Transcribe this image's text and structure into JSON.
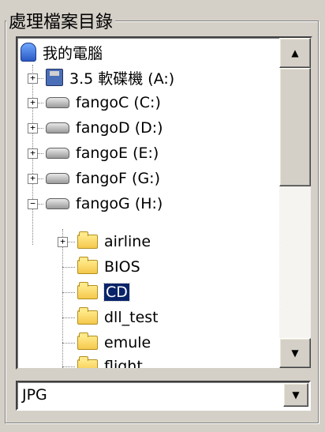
{
  "group_title": "處理檔案目錄",
  "tree": [
    {
      "label": "我的電腦",
      "icon": "computer-icon",
      "expander": ""
    },
    {
      "label": "3.5 軟碟機 (A:)",
      "icon": "floppy-drive-icon",
      "expander": "+"
    },
    {
      "label": "fangoC (C:)",
      "icon": "hard-drive-icon",
      "expander": "+"
    },
    {
      "label": "fangoD (D:)",
      "icon": "hard-drive-icon",
      "expander": "+"
    },
    {
      "label": "fangoE (E:)",
      "icon": "hard-drive-icon",
      "expander": "+"
    },
    {
      "label": "fangoF (G:)",
      "icon": "hard-drive-icon",
      "expander": "+"
    },
    {
      "label": "fangoG (H:)",
      "icon": "hard-drive-icon",
      "expander": "−"
    },
    {
      "label": "airline",
      "icon": "folder-icon",
      "expander": "+"
    },
    {
      "label": "BIOS",
      "icon": "folder-icon",
      "expander": ""
    },
    {
      "label": "CD",
      "icon": "folder-open-icon",
      "expander": "",
      "selected": true
    },
    {
      "label": "dll_test",
      "icon": "folder-icon",
      "expander": ""
    },
    {
      "label": "emule",
      "icon": "folder-icon",
      "expander": ""
    },
    {
      "label": "flight",
      "icon": "folder-icon",
      "expander": ""
    }
  ],
  "scroll": {
    "up_glyph": "▲",
    "down_glyph": "▼"
  },
  "filter": {
    "value": "JPG",
    "arrow_glyph": "▼"
  }
}
